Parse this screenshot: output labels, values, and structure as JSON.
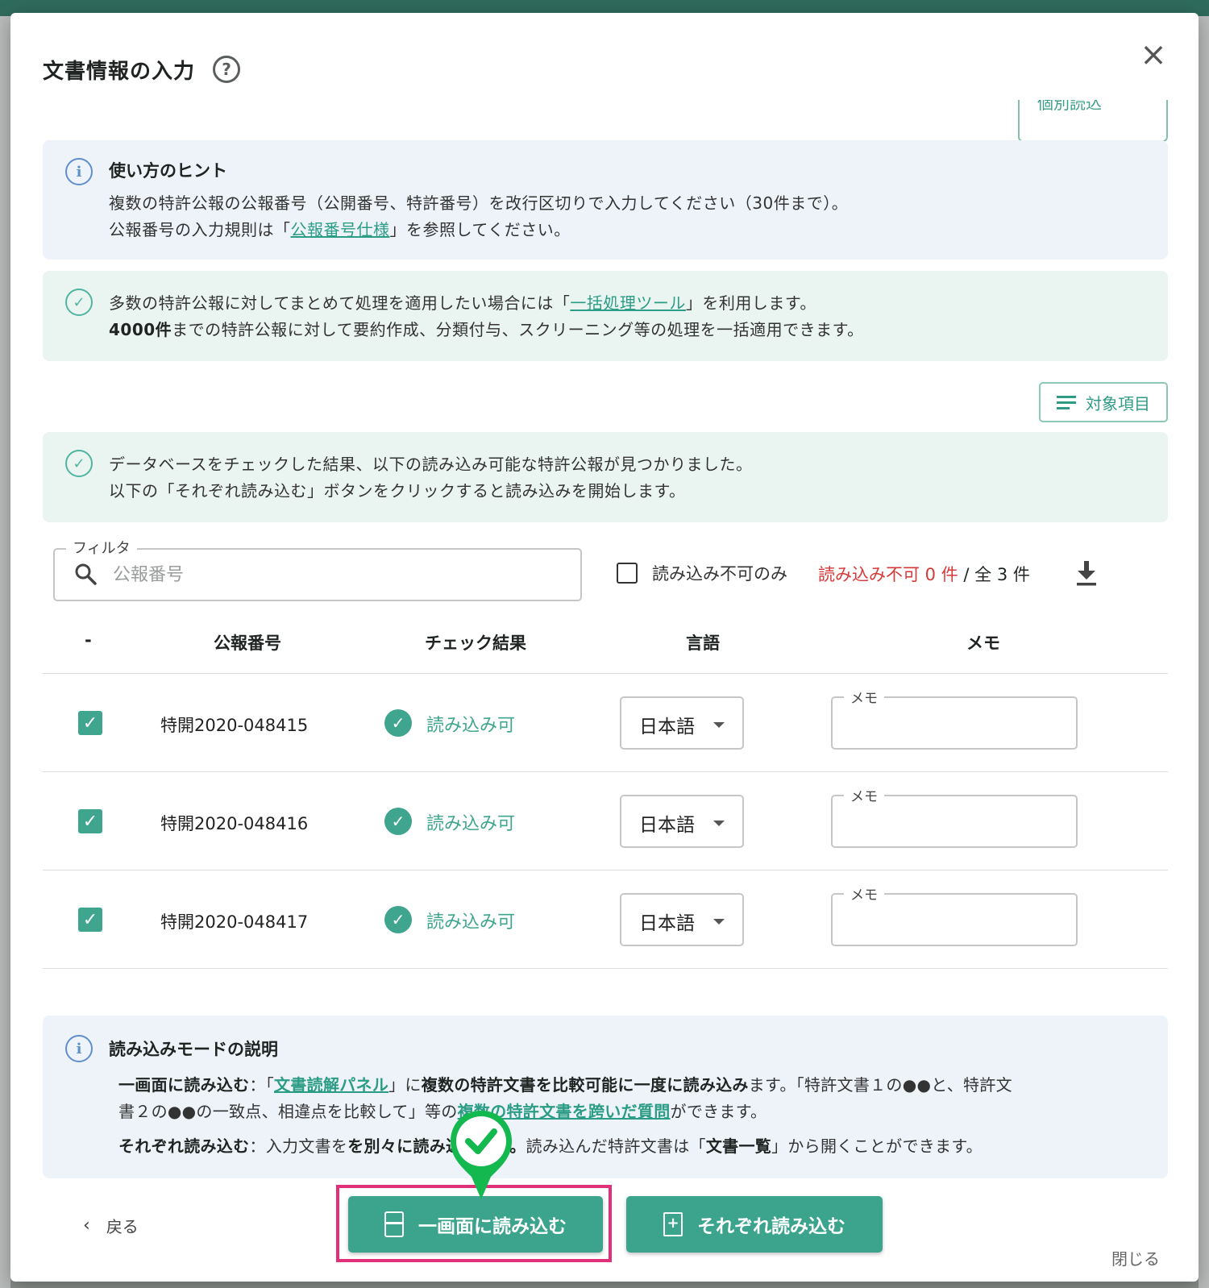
{
  "background": {
    "color": "#8a8f8c"
  },
  "dialog": {
    "title": "文書情報の入力",
    "help_icon": "?",
    "close_icon": "×",
    "partial_button_label": "個別読込"
  },
  "hint_usage": {
    "icon": "i",
    "title": "使い方のヒント",
    "line1": "複数の特許公報の公報番号（公開番号、特許番号）を改行区切りで入力してください（30件まで）。",
    "line2_before": "公報番号の入力規則は「",
    "line2_link": "公報番号仕様",
    "line2_after": "」を参照してください。"
  },
  "hint_batch": {
    "icon": "✓",
    "line1_before": "多数の特許公報に対してまとめて処理を適用したい場合には「",
    "line1_link": "一括処理ツール",
    "line1_after": "」を利用します。",
    "line2_bold": "4000件",
    "line2_rest": "までの特許公報に対して要約作成、分類付与、スクリーニング等の処理を一括適用できます。"
  },
  "target_items_button": "対象項目",
  "hint_result": {
    "icon": "✓",
    "line1": "データベースをチェックした結果、以下の読み込み可能な特許公報が見つかりました。",
    "line2": "以下の「それぞれ読み込む」ボタンをクリックすると読み込みを開始します。"
  },
  "filter": {
    "label": "フィルタ",
    "placeholder": "公報番号",
    "value": ""
  },
  "only_fail_label": "読み込み不可のみ",
  "counts": {
    "fail_text": "読み込み不可 0 件",
    "separator": " / ",
    "total_text": "全 3 件"
  },
  "table": {
    "columns": [
      "-",
      "公報番号",
      "チェック結果",
      "言語",
      "メモ"
    ],
    "rows": [
      {
        "checked": true,
        "number": "特開2020-048415",
        "status": "読み込み可",
        "language": "日本語",
        "memo_label": "メモ",
        "memo": ""
      },
      {
        "checked": true,
        "number": "特開2020-048416",
        "status": "読み込み可",
        "language": "日本語",
        "memo_label": "メモ",
        "memo": ""
      },
      {
        "checked": true,
        "number": "特開2020-048417",
        "status": "読み込み可",
        "language": "日本語",
        "memo_label": "メモ",
        "memo": ""
      }
    ]
  },
  "mode_explanation": {
    "icon": "i",
    "title": "読み込みモードの説明",
    "one_screen_bold": "一画面に読み込む",
    "one_screen_t1": "：「",
    "one_screen_link": "文書読解パネル",
    "one_screen_t2": "」に",
    "one_screen_bold2": "複数の特許文書を比較可能に一度に読み込み",
    "one_screen_t3": "ます。「特許文書１の●●と、特許文",
    "one_screen_line2_before": "書２の●●の一致点、相違点を比較して",
    "one_screen_line2_hidden": "」等の",
    "one_screen_link2": "複数の特許文書を跨いだ質問",
    "one_screen_line2_after": "ができます。",
    "each_bold": "それぞれ読み込む",
    "each_t1": "：入力文書を",
    "each_bold2": "を別々",
    "each_hidden": "に読み込",
    "each_bold3": "みます。",
    "each_t2": "読み込んだ特許文書は「",
    "each_bold4": "文書一覧",
    "each_t3": "」から開くことができます。"
  },
  "footer": {
    "back_label": "戻る",
    "one_screen_button": "一画面に読み込む",
    "each_button": "それぞれ読み込む",
    "close_label": "閉じる"
  },
  "colors": {
    "accent": "#3ca48d",
    "highlight": "#e0307a",
    "marker": "#13b84e",
    "fail": "#d43a3a"
  }
}
